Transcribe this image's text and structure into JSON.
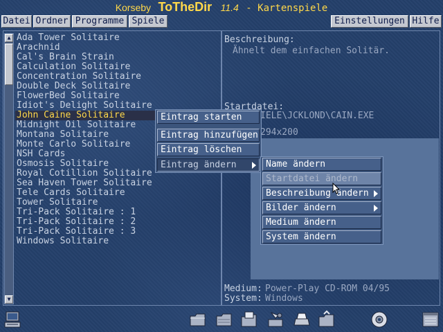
{
  "title": {
    "brand": "Korseby",
    "app": "ToTheDir",
    "version": "11.4",
    "subtitle": "- Kartenspiele"
  },
  "menubar": {
    "items": [
      "Datei",
      "Ordner",
      "Programme",
      "Spiele"
    ]
  },
  "toolbar_right": {
    "settings": "Einstellungen",
    "help": "Hilfe"
  },
  "games": [
    "Ada Tower Solitaire",
    "Arachnid",
    "Cal's Brain Strain",
    "Calculation Solitaire",
    "Concentration Solitaire",
    "Double Deck Solitaire",
    "FlowerBed Solitaire",
    "Idiot's Delight Solitaire",
    "John Caine Solitaire",
    "Midnight Oil Solitaire",
    "Montana Solitaire",
    "Monte Carlo Solitaire",
    "NSH Cards",
    "Osmosis Solitaire",
    "Royal Cotillion Solitaire",
    "Sea Haven Tower Solitaire",
    "Tele Cards Solitaire",
    "Tower Solitaire",
    "Tri-Pack Solitaire : 1",
    "Tri-Pack Solitaire : 2",
    "Tri-Pack Solitaire : 3",
    "Windows Solitaire"
  ],
  "selected_index": 8,
  "details": {
    "desc_label": "Beschreibung:",
    "desc_text": "Ähnelt dem einfachen Solitär.",
    "start_label": "Startdatei:",
    "start_value": "IELE\\JCKLOND\\CAIN.EXE",
    "resolution": "294x200",
    "medium_label": "Medium:",
    "medium_value": "Power-Play CD-ROM 04/95",
    "system_label": "System:",
    "system_value": "Windows"
  },
  "context_menu": {
    "items": [
      "Eintrag starten",
      "Eintrag hinzufügen",
      "Eintrag löschen",
      "Eintrag ändern"
    ]
  },
  "submenu": {
    "items": [
      "Name ändern",
      "Startdatei ändern",
      "Beschreibung ändern",
      "Bilder ändern",
      "Medium ändern",
      "System ändern"
    ]
  },
  "taskbar": {
    "icons": [
      "computer-icon",
      "folder-icon",
      "folder-icon",
      "folder-icon",
      "tools-icon",
      "printer-icon",
      "folder-icon",
      "cd-icon",
      "window-icon"
    ]
  },
  "colors": {
    "accent": "#ffd84a",
    "background": "#24406a",
    "button": "#c4c8d0"
  }
}
